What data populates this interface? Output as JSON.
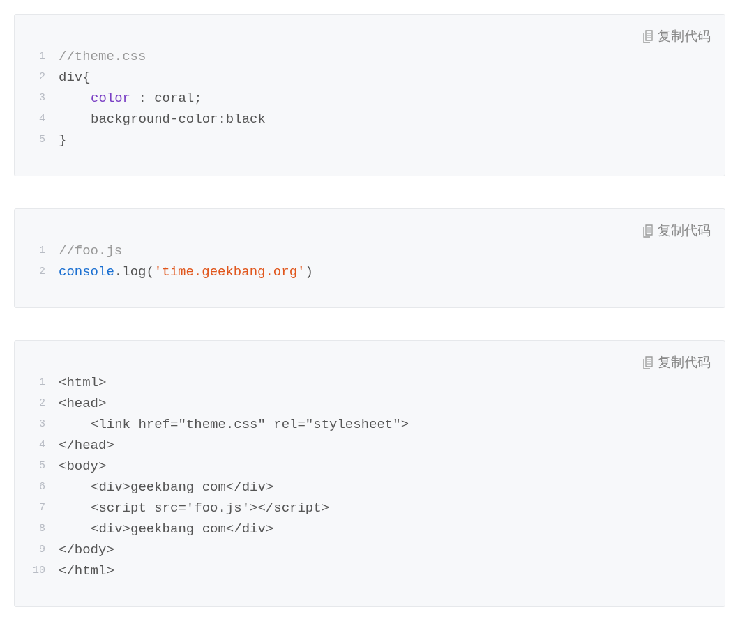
{
  "code_blocks": [
    {
      "copy_label": "复制代码",
      "lines": [
        {
          "number": "1",
          "indented": false,
          "tokens": [
            {
              "kind": "comment",
              "text": "//theme.css"
            }
          ]
        },
        {
          "number": "2",
          "indented": false,
          "tokens": [
            {
              "kind": "plain",
              "text": "div{"
            }
          ]
        },
        {
          "number": "3",
          "indented": true,
          "tokens": [
            {
              "kind": "keyword",
              "text": "color"
            },
            {
              "kind": "plain",
              "text": " : coral;"
            }
          ]
        },
        {
          "number": "4",
          "indented": true,
          "tokens": [
            {
              "kind": "plain",
              "text": "background-color:black"
            }
          ]
        },
        {
          "number": "5",
          "indented": false,
          "tokens": [
            {
              "kind": "plain",
              "text": "}"
            }
          ]
        }
      ]
    },
    {
      "copy_label": "复制代码",
      "lines": [
        {
          "number": "1",
          "indented": false,
          "tokens": [
            {
              "kind": "comment",
              "text": "//foo.js"
            }
          ]
        },
        {
          "number": "2",
          "indented": false,
          "tokens": [
            {
              "kind": "builtin",
              "text": "console"
            },
            {
              "kind": "plain",
              "text": ".log("
            },
            {
              "kind": "string",
              "text": "'time.geekbang.org'"
            },
            {
              "kind": "plain",
              "text": ")"
            }
          ]
        }
      ]
    },
    {
      "copy_label": "复制代码",
      "lines": [
        {
          "number": "1",
          "indented": false,
          "tokens": [
            {
              "kind": "plain",
              "text": "<html>"
            }
          ]
        },
        {
          "number": "2",
          "indented": false,
          "tokens": [
            {
              "kind": "plain",
              "text": "<head>"
            }
          ]
        },
        {
          "number": "3",
          "indented": true,
          "tokens": [
            {
              "kind": "plain",
              "text": "<link href=\"theme.css\" rel=\"stylesheet\">"
            }
          ]
        },
        {
          "number": "4",
          "indented": false,
          "tokens": [
            {
              "kind": "plain",
              "text": "</head>"
            }
          ]
        },
        {
          "number": "5",
          "indented": false,
          "tokens": [
            {
              "kind": "plain",
              "text": "<body>"
            }
          ]
        },
        {
          "number": "6",
          "indented": true,
          "tokens": [
            {
              "kind": "plain",
              "text": "<div>geekbang com</div>"
            }
          ]
        },
        {
          "number": "7",
          "indented": true,
          "tokens": [
            {
              "kind": "plain",
              "text": "<script src='foo.js'></script>"
            }
          ]
        },
        {
          "number": "8",
          "indented": true,
          "tokens": [
            {
              "kind": "plain",
              "text": "<div>geekbang com</div>"
            }
          ]
        },
        {
          "number": "9",
          "indented": false,
          "tokens": [
            {
              "kind": "plain",
              "text": "</body>"
            }
          ]
        },
        {
          "number": "10",
          "indented": false,
          "tokens": [
            {
              "kind": "plain",
              "text": "</html>"
            }
          ]
        }
      ]
    }
  ]
}
